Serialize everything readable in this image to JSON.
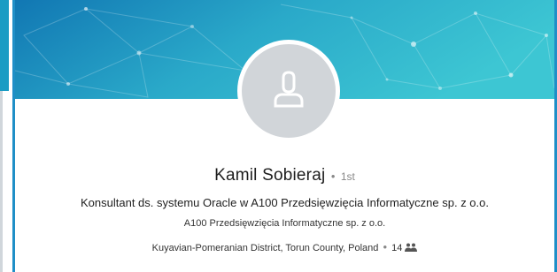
{
  "profile": {
    "name": "Kamil Sobieraj",
    "degree": "1st",
    "headline": "Konsultant ds. systemu Oracle w A100 Przedsięwzięcia Informatyczne sp. z o.o.",
    "company": "A100 Przedsięwzięcia Informatyczne sp. z o.o.",
    "location": "Kuyavian-Pomeranian District, Torun County, Poland",
    "connections": "14",
    "separator": "•"
  },
  "icons": {
    "avatar": "person-placeholder-icon",
    "connections": "connections-icon"
  },
  "colors": {
    "banner_dark": "#1177b3",
    "banner_light": "#39c3d4",
    "avatar_bg": "#d1d5d9",
    "frame": "#1f8fc7"
  }
}
